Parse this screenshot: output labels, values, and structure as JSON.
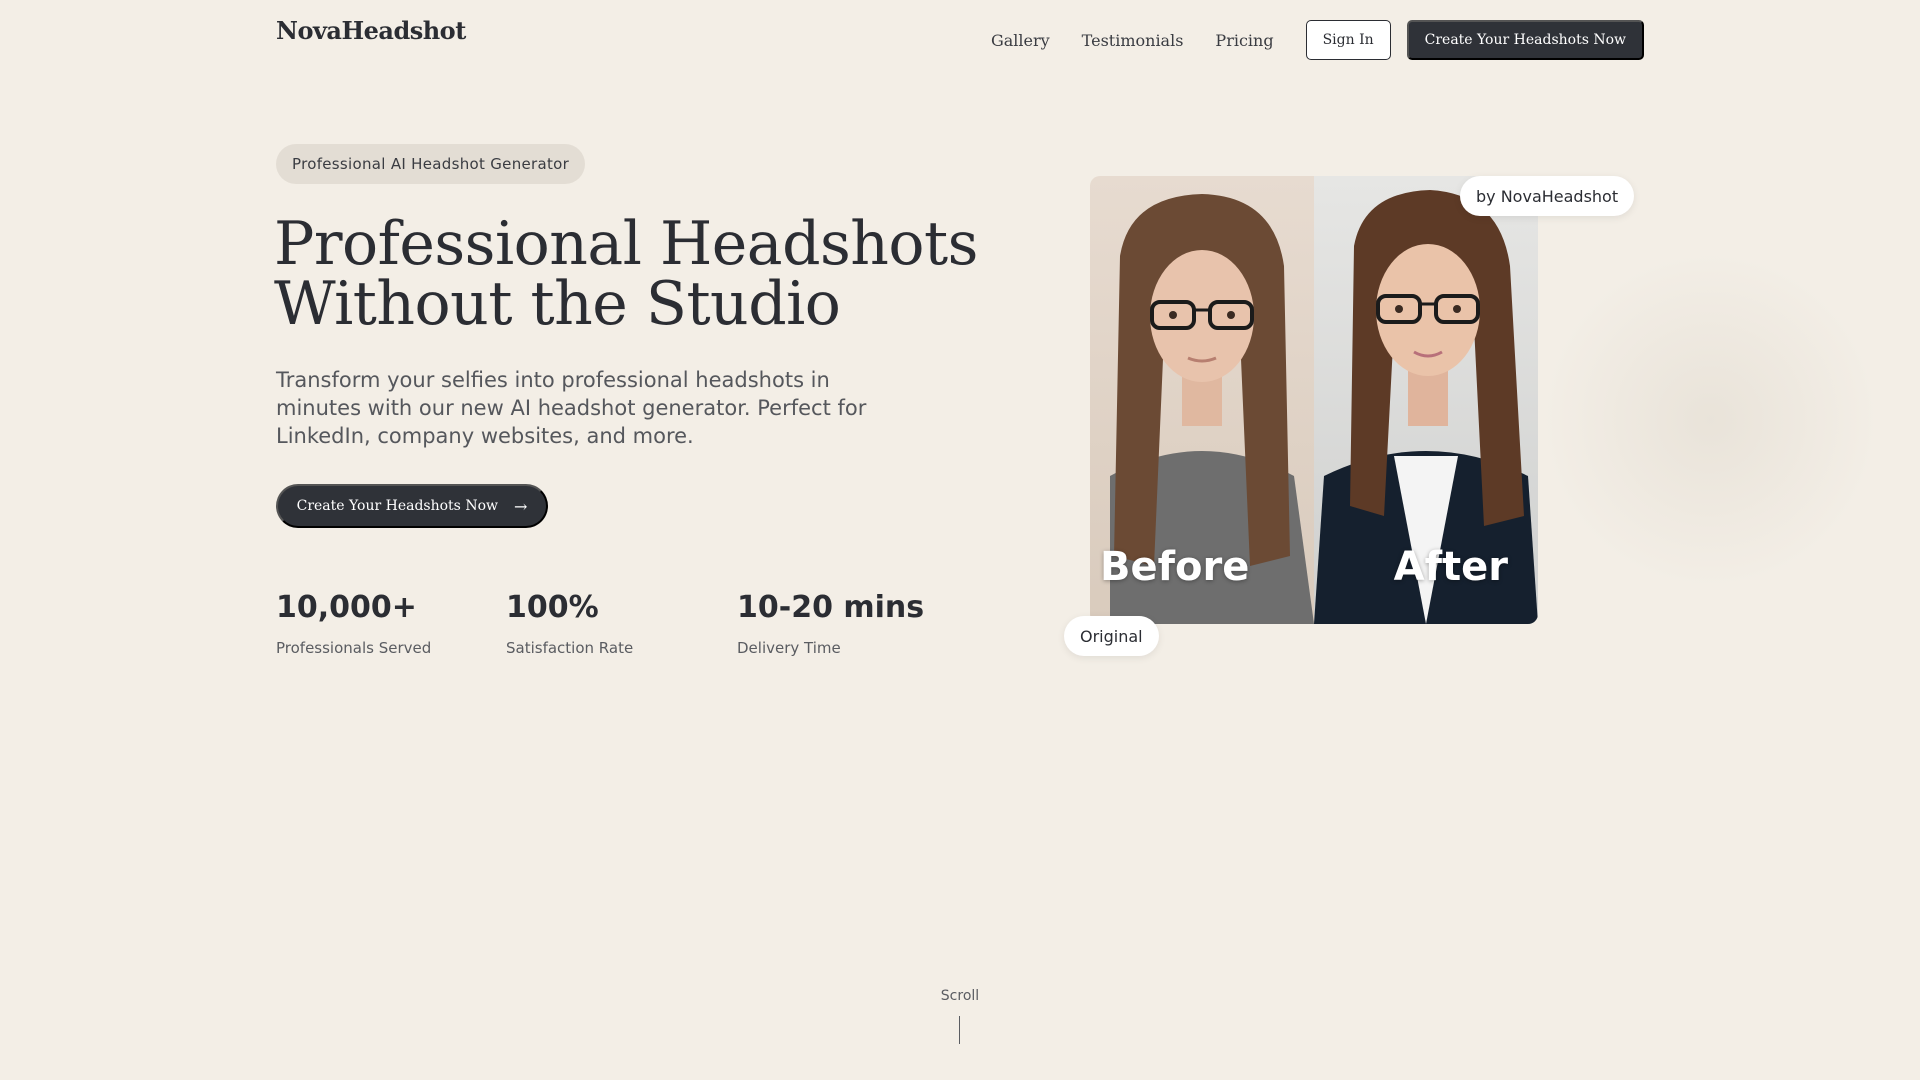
{
  "header": {
    "brand": "NovaHeadshot",
    "nav": [
      "Gallery",
      "Testimonials",
      "Pricing"
    ],
    "sign_in": "Sign In",
    "cta": "Create Your Headshots Now"
  },
  "hero": {
    "pill": "Professional AI Headshot Generator",
    "headline_line1": "Professional Headshots",
    "headline_line2": "Without the Studio",
    "subtext": "Transform your selfies into professional headshots in minutes with our new AI headshot generator. Perfect for LinkedIn, company websites, and more.",
    "cta": "Create Your Headshots Now",
    "cta_icon": "arrow-right-icon"
  },
  "stats": [
    {
      "value": "10,000+",
      "label": "Professionals Served"
    },
    {
      "value": "100%",
      "label": "Satisfaction Rate"
    },
    {
      "value": "10-20 mins",
      "label": "Delivery Time"
    }
  ],
  "showcase": {
    "before_label": "Before",
    "after_label": "After",
    "badge_top": "by NovaHeadshot",
    "badge_bottom": "Original"
  },
  "scroll": "Scroll",
  "colors": {
    "background": "#f3eee6",
    "dark": "#2f3238",
    "pill": "#e3ddd4"
  }
}
